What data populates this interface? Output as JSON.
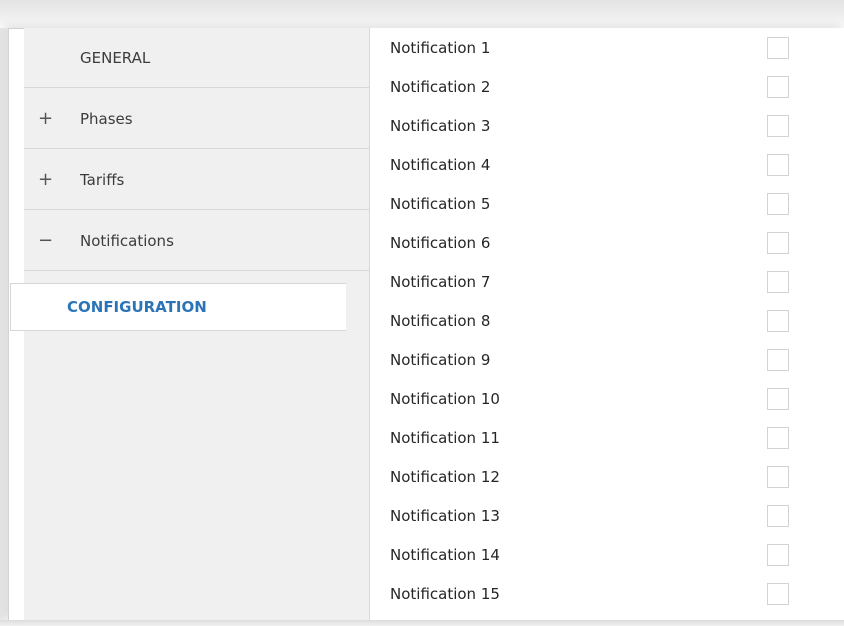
{
  "sidebar": {
    "items": [
      {
        "sign": "",
        "label": "GENERAL"
      },
      {
        "sign": "+",
        "label": "Phases"
      },
      {
        "sign": "+",
        "label": "Tariffs"
      },
      {
        "sign": "−",
        "label": "Notifications"
      }
    ],
    "sub_item": {
      "label": "CONFIGURATION"
    }
  },
  "notifications": [
    {
      "label": "Notification 1",
      "checked": false
    },
    {
      "label": "Notification 2",
      "checked": false
    },
    {
      "label": "Notification 3",
      "checked": false
    },
    {
      "label": "Notification 4",
      "checked": false
    },
    {
      "label": "Notification 5",
      "checked": false
    },
    {
      "label": "Notification 6",
      "checked": false
    },
    {
      "label": "Notification 7",
      "checked": false
    },
    {
      "label": "Notification 8",
      "checked": false
    },
    {
      "label": "Notification 9",
      "checked": false
    },
    {
      "label": "Notification 10",
      "checked": false
    },
    {
      "label": "Notification 11",
      "checked": false
    },
    {
      "label": "Notification 12",
      "checked": false
    },
    {
      "label": "Notification 13",
      "checked": false
    },
    {
      "label": "Notification 14",
      "checked": false
    },
    {
      "label": "Notification 15",
      "checked": false
    }
  ],
  "colors": {
    "accent": "#2b74b8",
    "sidebar_bg": "#f0f0f0"
  }
}
